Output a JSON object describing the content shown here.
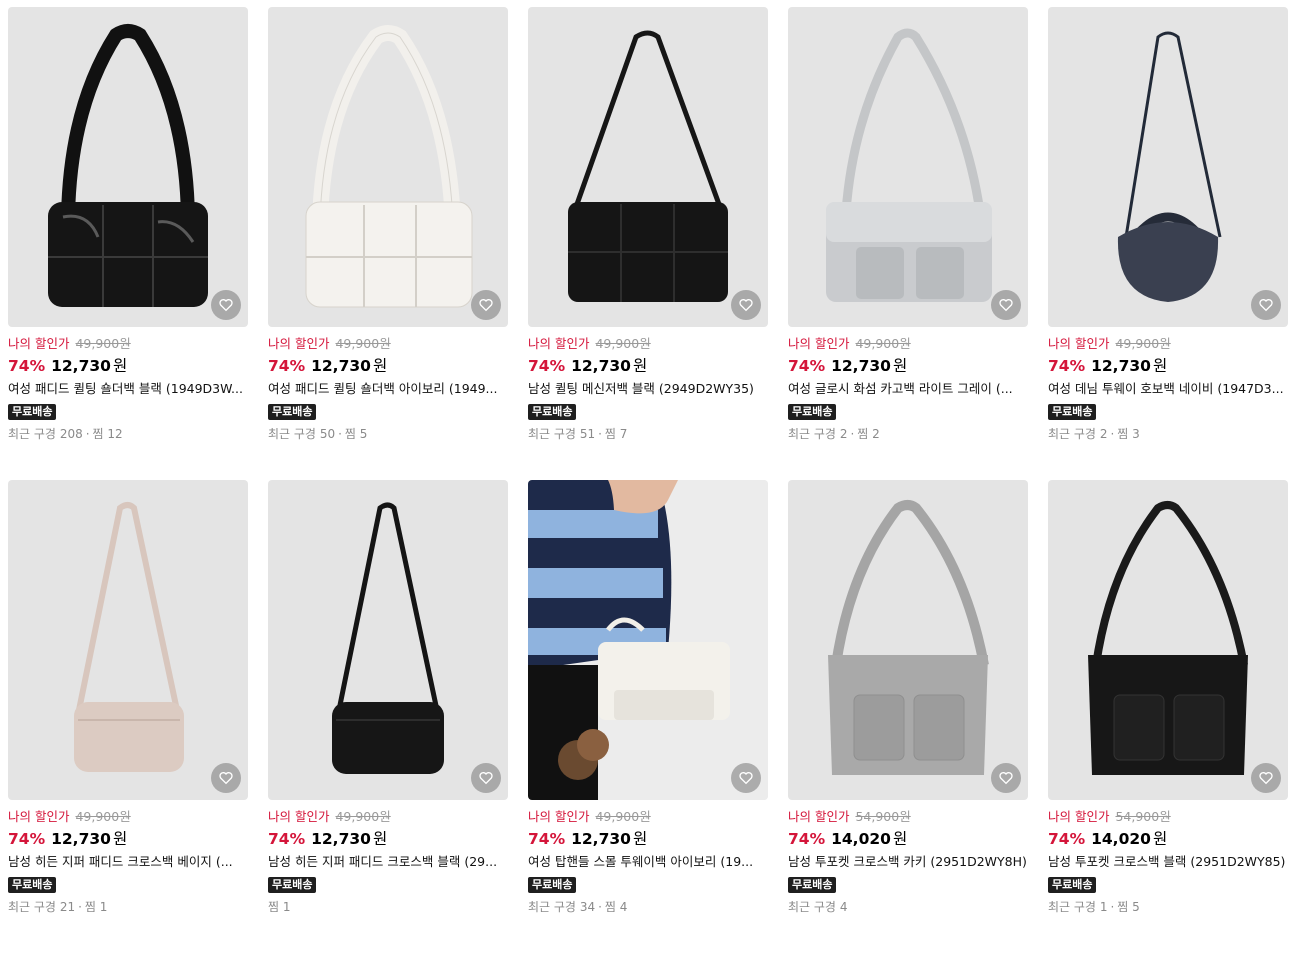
{
  "icons": {
    "like": "heart-icon"
  },
  "colors": {
    "discount": "#d4153a",
    "badge_bg": "#1f1f1f"
  },
  "products": [
    {
      "my_price_label": "나의 할인가",
      "original_price": "49,900원",
      "discount_rate": "74%",
      "price": "12,730",
      "currency": "원",
      "title": "여성 패디드 퀼팅 숄더백 블랙 (1949D3W...",
      "badge": "무료배송",
      "recent_label": "최근 구경",
      "recent_count": "208",
      "wish_label": "찜",
      "wish_count": "12",
      "bag": "black-glossy-shoulder"
    },
    {
      "my_price_label": "나의 할인가",
      "original_price": "49,900원",
      "discount_rate": "74%",
      "price": "12,730",
      "currency": "원",
      "title": "여성 패디드 퀼팅 숄더백 아이보리 (1949...",
      "badge": "무료배송",
      "recent_label": "최근 구경",
      "recent_count": "50",
      "wish_label": "찜",
      "wish_count": "5",
      "bag": "ivory-shoulder"
    },
    {
      "my_price_label": "나의 할인가",
      "original_price": "49,900원",
      "discount_rate": "74%",
      "price": "12,730",
      "currency": "원",
      "title": "남성 퀼팅 메신저백 블랙 (2949D2WY35)",
      "badge": "무료배송",
      "recent_label": "최근 구경",
      "recent_count": "51",
      "wish_label": "찜",
      "wish_count": "7",
      "bag": "black-messenger"
    },
    {
      "my_price_label": "나의 할인가",
      "original_price": "49,900원",
      "discount_rate": "74%",
      "price": "12,730",
      "currency": "원",
      "title": "여성 글로시 화섬 카고백 라이트 그레이 (...",
      "badge": "무료배송",
      "recent_label": "최근 구경",
      "recent_count": "2",
      "wish_label": "찜",
      "wish_count": "2",
      "bag": "silver-cargo"
    },
    {
      "my_price_label": "나의 할인가",
      "original_price": "49,900원",
      "discount_rate": "74%",
      "price": "12,730",
      "currency": "원",
      "title": "여성 데님 투웨이 호보백 네이비 (1947D3...",
      "badge": "무료배송",
      "recent_label": "최근 구경",
      "recent_count": "2",
      "wish_label": "찜",
      "wish_count": "3",
      "bag": "navy-hobo"
    },
    {
      "my_price_label": "나의 할인가",
      "original_price": "49,900원",
      "discount_rate": "74%",
      "price": "12,730",
      "currency": "원",
      "title": "남성 히든 지퍼 패디드 크로스백 베이지 (...",
      "badge": "무료배송",
      "recent_label": "최근 구경",
      "recent_count": "21",
      "wish_label": "찜",
      "wish_count": "1",
      "bag": "beige-cross"
    },
    {
      "my_price_label": "나의 할인가",
      "original_price": "49,900원",
      "discount_rate": "74%",
      "price": "12,730",
      "currency": "원",
      "title": "남성 히든 지퍼 패디드 크로스백 블랙 (29...",
      "badge": "무료배송",
      "recent_label": "",
      "recent_count": "",
      "wish_label": "찜",
      "wish_count": "1",
      "bag": "black-cross"
    },
    {
      "my_price_label": "나의 할인가",
      "original_price": "49,900원",
      "discount_rate": "74%",
      "price": "12,730",
      "currency": "원",
      "title": "여성 탑핸들 스몰 투웨이백 아이보리 (19...",
      "badge": "무료배송",
      "recent_label": "최근 구경",
      "recent_count": "34",
      "wish_label": "찜",
      "wish_count": "4",
      "bag": "ivory-tophandle-photo"
    },
    {
      "my_price_label": "나의 할인가",
      "original_price": "54,900원",
      "discount_rate": "74%",
      "price": "14,020",
      "currency": "원",
      "title": "남성 투포켓 크로스백 카키 (2951D2WY8H)",
      "badge": "무료배송",
      "recent_label": "최근 구경",
      "recent_count": "4",
      "wish_label": "",
      "wish_count": "",
      "bag": "khaki-twopocket"
    },
    {
      "my_price_label": "나의 할인가",
      "original_price": "54,900원",
      "discount_rate": "74%",
      "price": "14,020",
      "currency": "원",
      "title": "남성 투포켓 크로스백 블랙 (2951D2WY85)",
      "badge": "무료배송",
      "recent_label": "최근 구경",
      "recent_count": "1",
      "wish_label": "찜",
      "wish_count": "5",
      "bag": "black-twopocket"
    }
  ]
}
